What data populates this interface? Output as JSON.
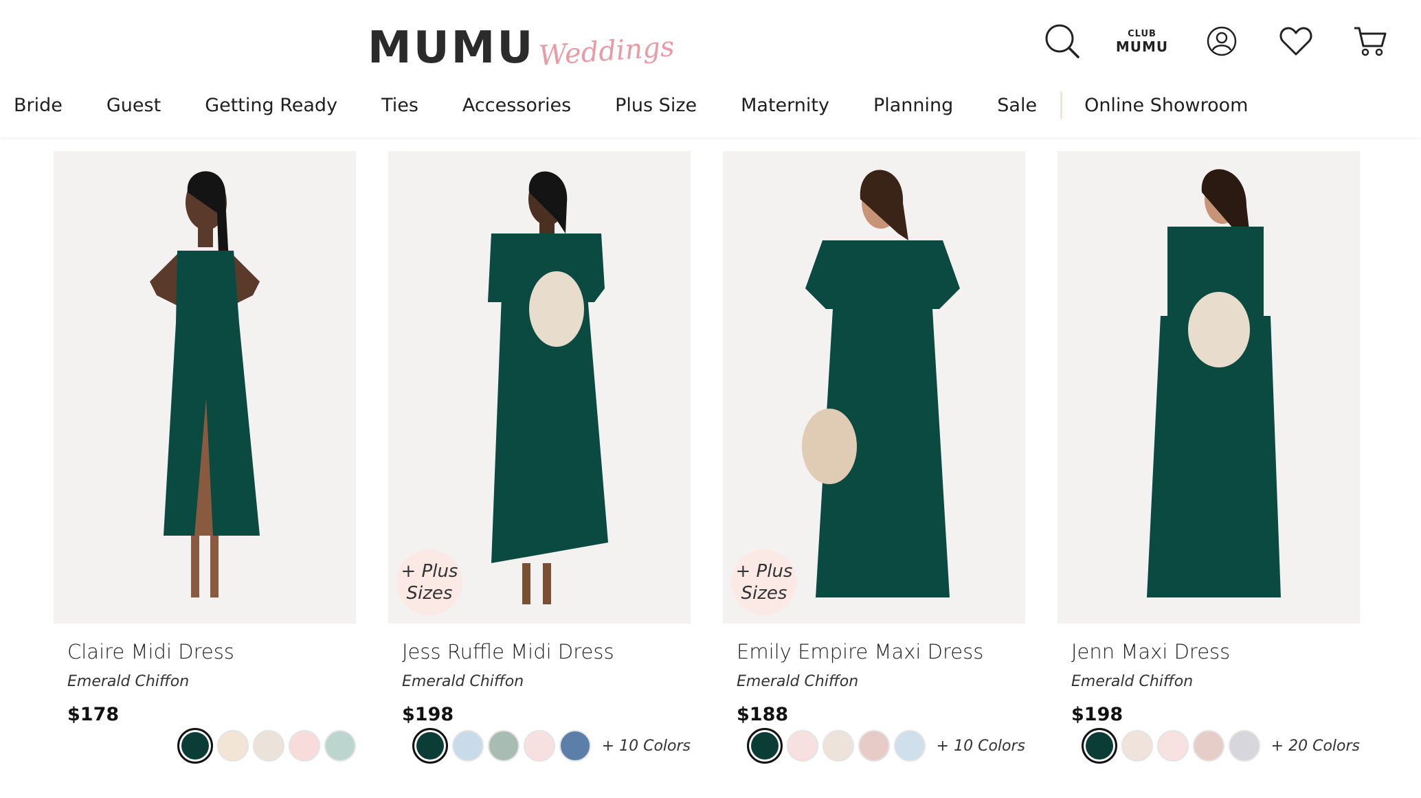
{
  "header": {
    "logo_main": "MUMU",
    "logo_script": "Weddings",
    "club_top": "CLUB",
    "club_bottom": "MUMU"
  },
  "nav": {
    "items": [
      "Bride",
      "Guest",
      "Getting Ready",
      "Ties",
      "Accessories",
      "Plus Size",
      "Maternity",
      "Planning",
      "Sale"
    ],
    "showroom": "Online Showroom"
  },
  "colors": {
    "emerald": "#0b4a40",
    "badge_bg": "#fbe9e6",
    "nav_divider": "#f0e6d4"
  },
  "products": [
    {
      "name": "Claire Midi Dress",
      "fabric": "Emerald Chiffon",
      "price": "$178",
      "badge_line1": "",
      "badge_line2": "",
      "swatches": [
        "#0b3d36",
        "#f3e5d5",
        "#ebe3d9",
        "#f7dcdb",
        "#bcd6cf"
      ],
      "more_colors": ""
    },
    {
      "name": "Jess Ruffle Midi Dress",
      "fabric": "Emerald Chiffon",
      "price": "$198",
      "badge_line1": "+ Plus",
      "badge_line2": "Sizes",
      "swatches": [
        "#0b3d36",
        "#c8dbe9",
        "#a9bcb3",
        "#f6e1e0",
        "#5b7fa8"
      ],
      "more_colors": "+ 10 Colors"
    },
    {
      "name": "Emily Empire Maxi Dress",
      "fabric": "Emerald Chiffon",
      "price": "$188",
      "badge_line1": "+ Plus",
      "badge_line2": "Sizes",
      "swatches": [
        "#0b3d36",
        "#f7e1e0",
        "#eee3da",
        "#e6cbc6",
        "#cfdfeb"
      ],
      "more_colors": "+ 10 Colors"
    },
    {
      "name": "Jenn Maxi Dress",
      "fabric": "Emerald Chiffon",
      "price": "$198",
      "badge_line1": "",
      "badge_line2": "",
      "swatches": [
        "#0b3d36",
        "#efe3db",
        "#f8e1e1",
        "#e6cdc8",
        "#d6d6dc"
      ],
      "more_colors": "+ 20 Colors"
    }
  ]
}
